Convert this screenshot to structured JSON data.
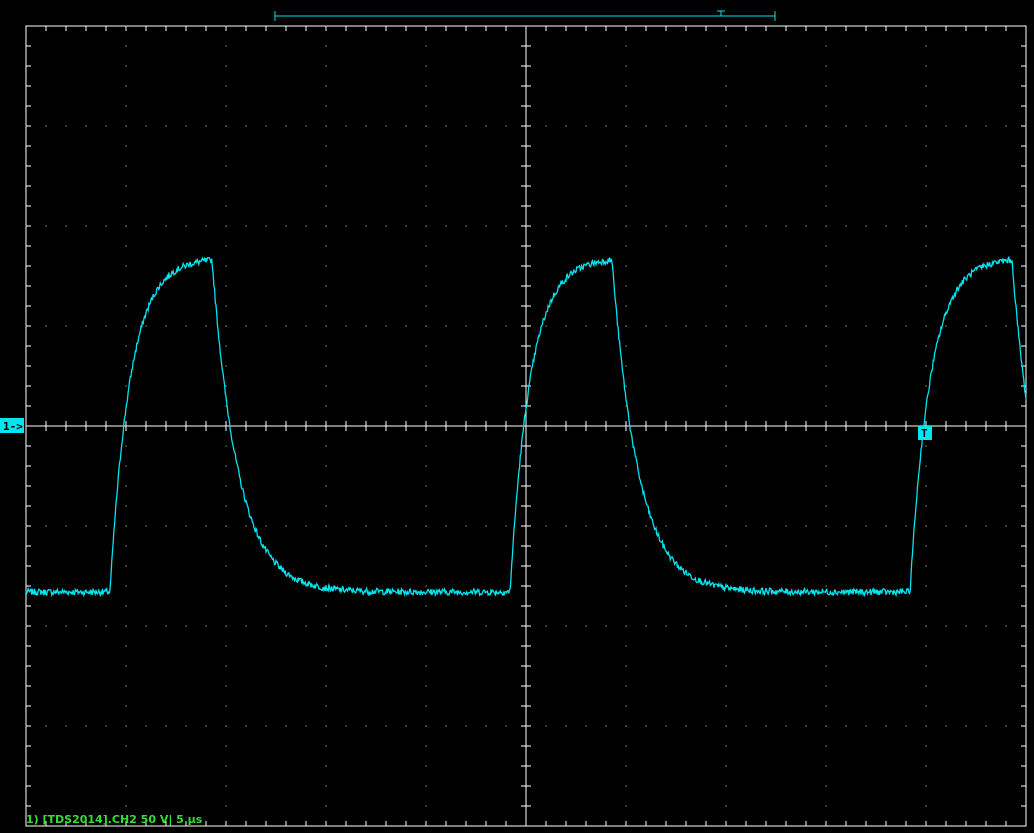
{
  "colors": {
    "background": "#000000",
    "grid": "#ffffff",
    "trace": "#00e5ee",
    "marker_bg": "#00e5ee",
    "marker_text": "#000000",
    "status_text": "#33dd33"
  },
  "marker": {
    "channel_ref": "1->",
    "trigger": "T"
  },
  "status": {
    "line": "1) [TDS2014].CH2  50  V|  5 µs"
  },
  "chart_data": {
    "type": "line",
    "title": "",
    "xlabel": "",
    "ylabel": "",
    "x_unit": "µs",
    "y_unit": "V",
    "volts_per_div": 50,
    "time_per_div_us": 5,
    "xlim": [
      -25,
      25
    ],
    "ylim": [
      -200,
      200
    ],
    "grid": true,
    "divisions": {
      "x": 10,
      "y": 8
    },
    "trigger_x": 20,
    "trigger_level": 0,
    "series": [
      {
        "values_model": "square-wave",
        "period_us": 20,
        "low_level": -83,
        "high_level": 84,
        "rise_start_us": -20.8,
        "rise_tau_us": 1.0,
        "fall_start_us": -15.7,
        "fall_tau_us": 1.3,
        "x": [
          -25,
          -20.8,
          -20.6,
          -20.2,
          -20.0,
          -19.6,
          -19.0,
          -18.0,
          -17.0,
          -15.7,
          -15.4,
          -15.0,
          -14.4,
          -13.6,
          -12.6,
          -11.0,
          -10.8,
          -10.6,
          -10.2,
          -10.0,
          -9.6,
          -9.0,
          -8.0,
          -7.0,
          -5.7,
          -5.4,
          -5.0,
          -4.4,
          -3.6,
          -2.6,
          -1.0,
          -0.8,
          -0.6,
          -0.2,
          0.0,
          0.4,
          1.0,
          2.0,
          3.0,
          4.3,
          4.6,
          5.0,
          5.6,
          6.4,
          7.4,
          9.0,
          9.2,
          9.4,
          9.8,
          10.0,
          10.4,
          11.0,
          12.0,
          13.0,
          14.3,
          14.6,
          15.0,
          15.6,
          16.4,
          17.4,
          19.0,
          19.2,
          19.4,
          19.8,
          20.0,
          20.4,
          21.0,
          22.0,
          23.0,
          24.0,
          25.0
        ],
        "values": [
          -83,
          -83,
          -62,
          -22,
          0,
          38,
          62,
          76,
          81,
          84,
          66,
          30,
          0,
          -40,
          -66,
          -82,
          -83,
          -62,
          -22,
          0,
          38,
          62,
          76,
          81,
          84,
          66,
          30,
          0,
          -40,
          -66,
          -82,
          -83,
          -62,
          -22,
          0,
          38,
          62,
          76,
          81,
          84,
          66,
          30,
          0,
          -40,
          -66,
          -82,
          -83,
          -62,
          -22,
          0,
          38,
          62,
          76,
          81,
          84,
          66,
          30,
          0,
          -40,
          -66,
          -82,
          -83,
          -62,
          -22,
          0,
          38,
          62,
          76,
          81,
          82,
          83
        ]
      }
    ]
  }
}
